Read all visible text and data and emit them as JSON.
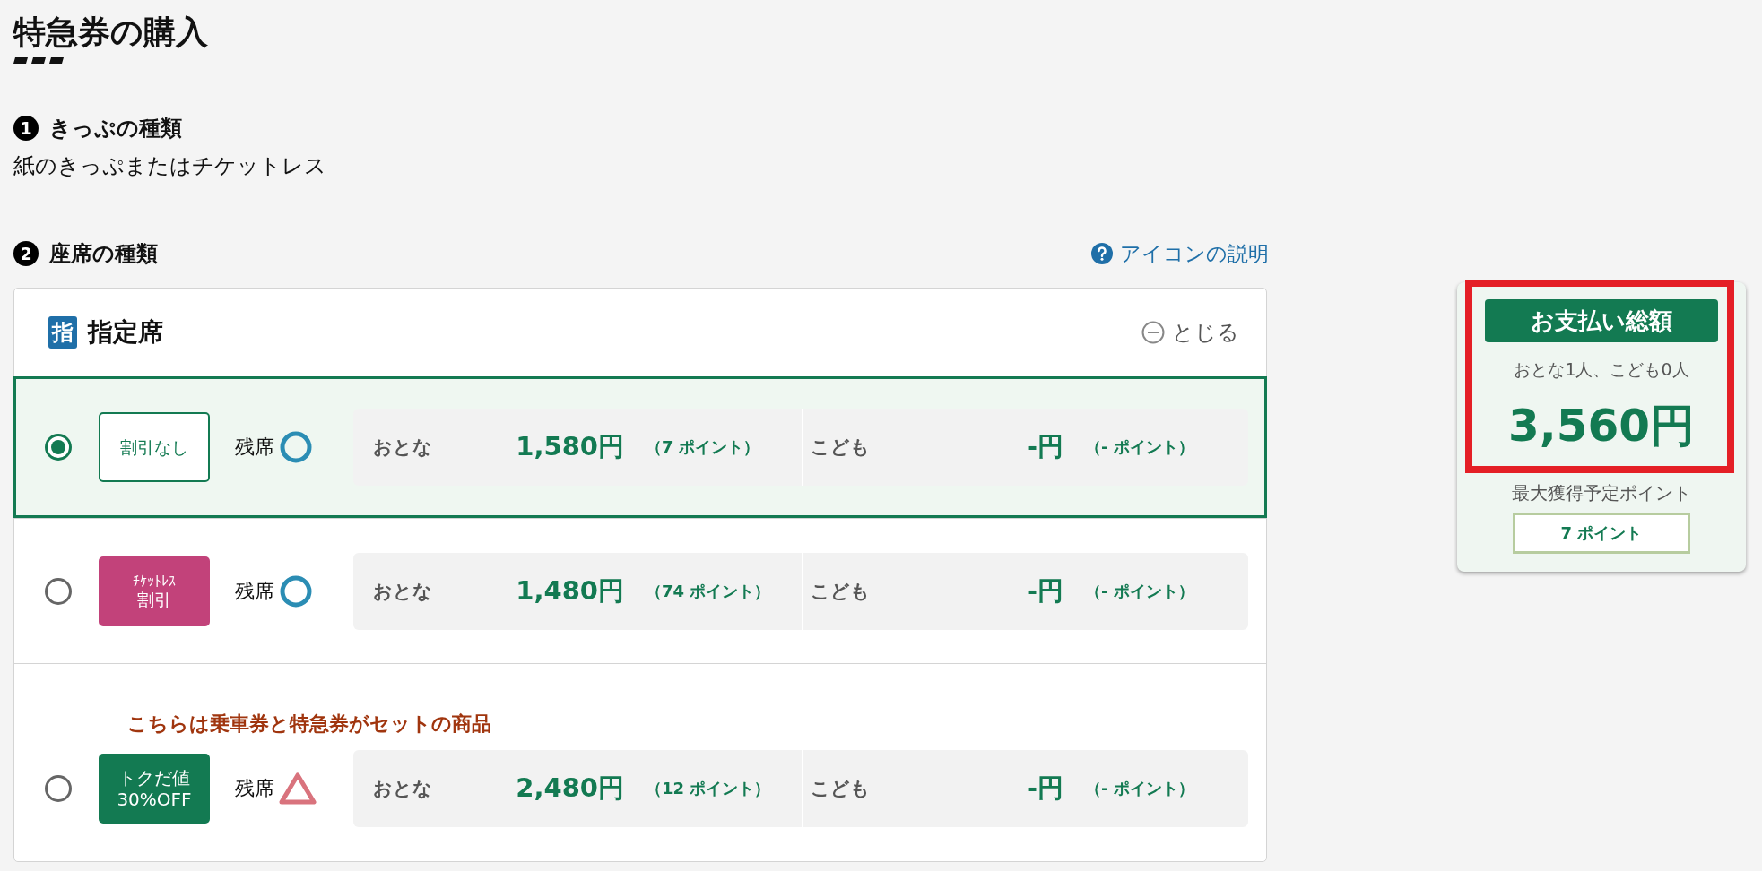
{
  "page_title": "特急券の購入",
  "steps": [
    {
      "number": "1",
      "title": "きっぷの種類",
      "value": "紙のきっぷまたはチケットレス"
    },
    {
      "number": "2",
      "title": "座席の種類",
      "help_link": "アイコンの説明"
    }
  ],
  "seat_card": {
    "badge": "指",
    "title": "指定席",
    "close_label": "とじる",
    "expanded": true,
    "rows": [
      {
        "selected": true,
        "badge": {
          "kind": "outline",
          "lines": [
            "割引なし"
          ]
        },
        "availability": {
          "label": "残席",
          "kind": "circle"
        },
        "adult_label": "おとな",
        "adult_price": "1,580円",
        "adult_points": "（7 ポイント）",
        "child_label": "こども",
        "child_price": "-円",
        "child_points": "（- ポイント）"
      },
      {
        "selected": false,
        "badge": {
          "kind": "ticketless",
          "lines": [
            "ﾁｹｯﾄﾚｽ",
            "割引"
          ]
        },
        "availability": {
          "label": "残席",
          "kind": "circle"
        },
        "adult_label": "おとな",
        "adult_price": "1,480円",
        "adult_points": "（74 ポイント）",
        "child_label": "こども",
        "child_price": "-円",
        "child_points": "（- ポイント）"
      },
      {
        "selected": false,
        "notice": "こちらは乗車券と特急券がセットの商品",
        "badge": {
          "kind": "deal",
          "lines": [
            "トクだ値",
            "30%OFF"
          ]
        },
        "availability": {
          "label": "残席",
          "kind": "triangle"
        },
        "adult_label": "おとな",
        "adult_price": "2,480円",
        "adult_points": "（12 ポイント）",
        "child_label": "こども",
        "child_price": "-円",
        "child_points": "（- ポイント）"
      }
    ]
  },
  "summary": {
    "heading": "お支払い総額",
    "passengers": "おとな1人、こども0人",
    "total": "3,560円",
    "highlighted": true,
    "points_label": "最大獲得予定ポイント",
    "points": "7 ポイント"
  }
}
